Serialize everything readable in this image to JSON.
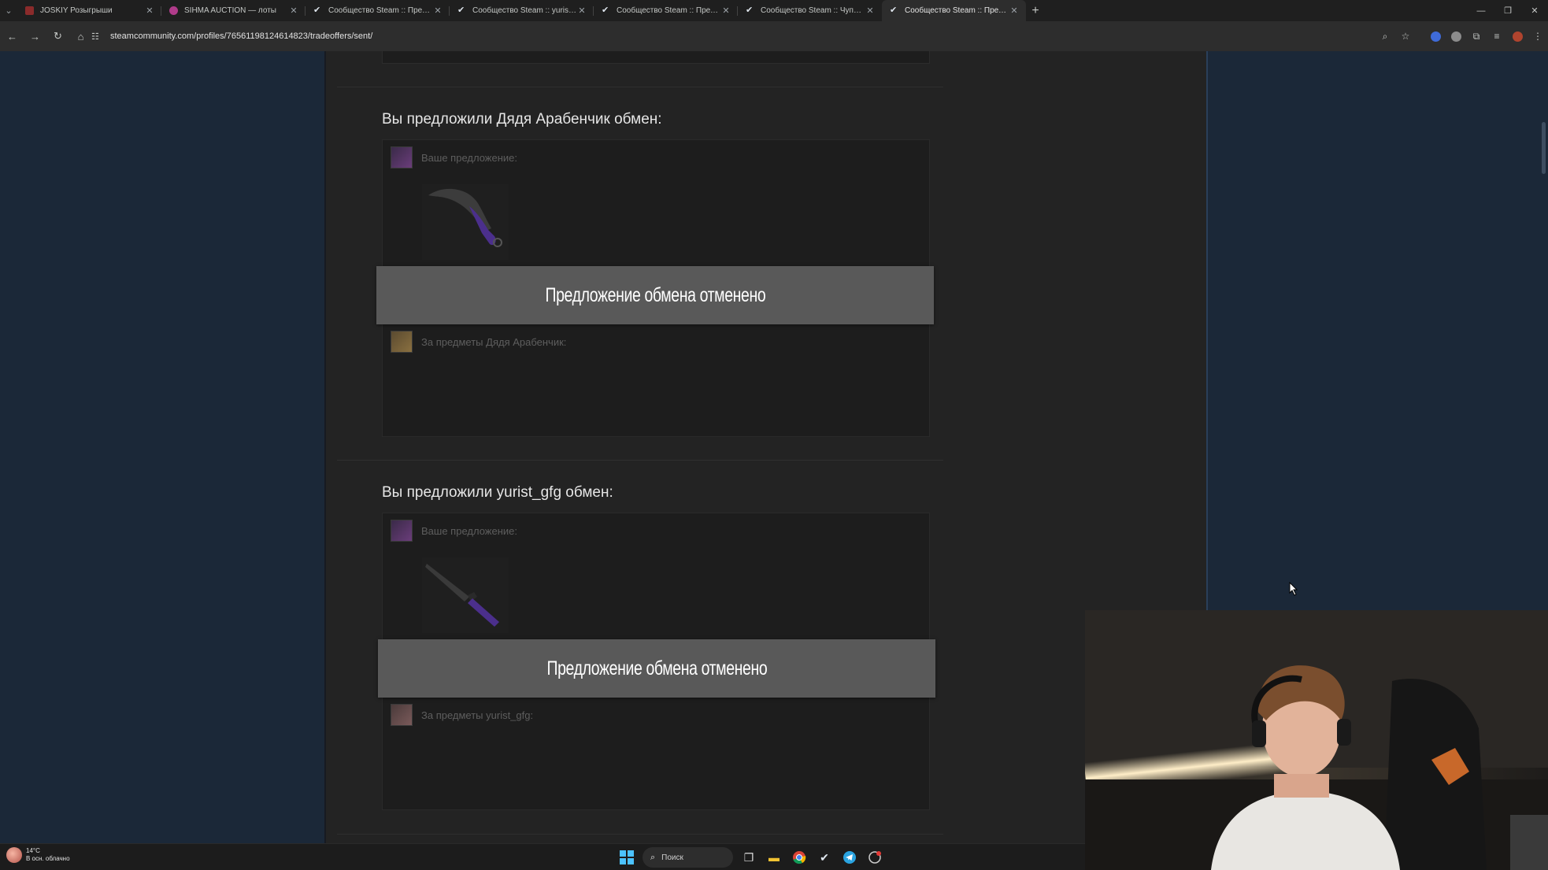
{
  "browser": {
    "tabs": [
      {
        "title": "JOSKIY Розыгрыши",
        "favicon_color": "#8b2b2b",
        "active": false
      },
      {
        "title": "SIHMA AUCTION — лоты",
        "favicon_color": "#b03b8a",
        "active": false
      },
      {
        "title": "Сообщество Steam :: Предложения",
        "favicon_color": "#dfe6ee",
        "active": false
      },
      {
        "title": "Сообщество Steam :: yurist_gfg",
        "favicon_color": "#dfe6ee",
        "active": false
      },
      {
        "title": "Сообщество Steam :: Предложения",
        "favicon_color": "#dfe6ee",
        "active": false
      },
      {
        "title": "Сообщество Steam :: Чупа и Н",
        "favicon_color": "#dfe6ee",
        "active": false
      },
      {
        "title": "Сообщество Steam :: Предложения",
        "favicon_color": "#dfe6ee",
        "active": true
      }
    ],
    "url": "steamcommunity.com/profiles/76561198124614823/tradeoffers/sent/"
  },
  "offers": [
    {
      "title": "Вы предложили Дядя Арабенчик обмен:",
      "your_offer_label": "Ваше предложение:",
      "item_icon": "karambit-knife-icon",
      "status": "Предложение обмена отменено",
      "their_items_label": "За предметы Дядя Арабенчик:"
    },
    {
      "title": "Вы предложили yurist_gfg обмен:",
      "your_offer_label": "Ваше предложение:",
      "item_icon": "bayonet-knife-icon",
      "status": "Предложение обмена отменено",
      "their_items_label": "За предметы yurist_gfg:"
    }
  ],
  "taskbar": {
    "weather_temp": "14°C",
    "weather_desc": "В осн. облачно",
    "search_placeholder": "Поиск"
  },
  "colors": {
    "page_bg": "#1b2838",
    "content_bg": "#232323",
    "banner_bg": "#595959",
    "item_purple": "#5a3fa0"
  }
}
